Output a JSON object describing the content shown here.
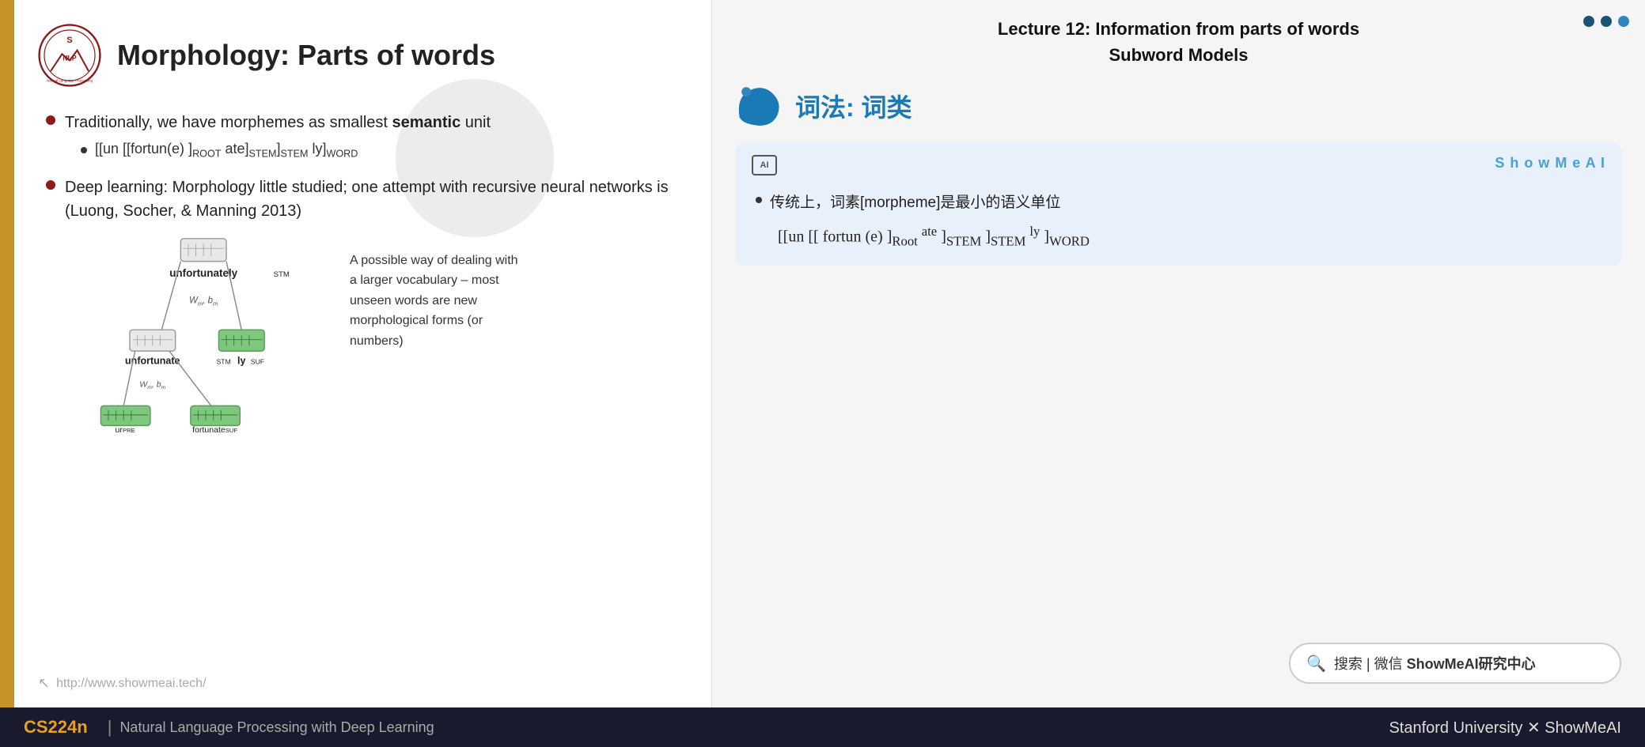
{
  "slide": {
    "left_bar_color": "#c8922a",
    "title": "Morphology: Parts of words",
    "bullet1": {
      "text_before": "Traditionally, we have morphemes as smallest ",
      "text_bold": "semantic",
      "text_after": " unit",
      "sub_bullet": "[[un [[fortun(e) ]ROOT ate]STEM]STEM ly]WORD"
    },
    "bullet2": {
      "text": "Deep learning: Morphology little studied; one attempt with recursive neural networks is (Luong, Socher, & Manning 2013)"
    },
    "diagram_caption": "A possible way of dealing with a larger vocabulary – most unseen words are new morphological forms (or numbers)",
    "url": "http://www.showmeai.tech/"
  },
  "right_panel": {
    "lecture_line1": "Lecture 12: Information from parts of words",
    "lecture_line2": "Subword Models",
    "chinese_title": "词法: 词类",
    "nav_dots": [
      "active",
      "active",
      "inactive"
    ],
    "translation_box": {
      "ai_icon": "AI",
      "brand": "S h o w M e A I",
      "bullet": "传统上，词素[morpheme]是最小的语义单位",
      "formula": "[[un [[ fortun (e) ] Root  ate ] STEM ] STEM  ly ] WORD"
    },
    "search_bar": {
      "icon": "🔍",
      "text": "搜索 | 微信 ShowMeAI研究中心"
    }
  },
  "bottom_bar": {
    "cs_label": "CS224n",
    "divider": "|",
    "subtitle": "Natural Language Processing with Deep Learning",
    "right_text": "Stanford University  ✕  ShowMeAI"
  },
  "icons": {
    "cursor_icon": "↖",
    "search_icon": "🔍"
  }
}
